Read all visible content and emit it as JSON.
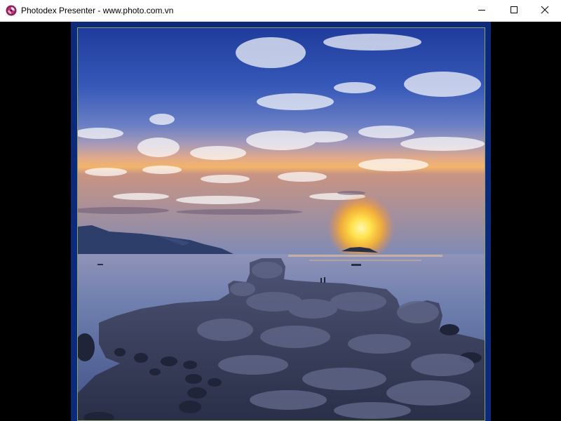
{
  "window": {
    "title": "Photodex Presenter - www.photo.com.vn",
    "app_icon": "photodex-logo-icon",
    "controls": {
      "minimize_icon": "minimize-icon",
      "maximize_icon": "maximize-icon",
      "close_icon": "close-icon"
    }
  },
  "photo": {
    "subject": "sunset-over-sea-with-rocks",
    "frame_color": "#0b2a7a",
    "frame_border_color": "#8aa36a"
  }
}
